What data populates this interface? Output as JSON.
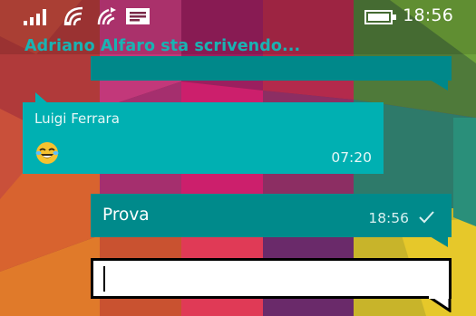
{
  "status_bar": {
    "icons": [
      "signal-bars-icon",
      "wifi-icon",
      "data-transfer-icon",
      "message-notification-icon",
      "battery-icon"
    ],
    "time": "18:56"
  },
  "chat": {
    "typing_indicator": "Adriano Alfaro sta scrivendo...",
    "messages": [
      {
        "direction": "outgoing",
        "text": "",
        "time": "",
        "clipped": true
      },
      {
        "direction": "incoming",
        "sender": "Luigi Ferrara",
        "emoji": "face-with-tears-of-joy",
        "time": "07:20"
      },
      {
        "direction": "outgoing",
        "text": "Prova",
        "time": "18:56",
        "status": "sent-check-icon"
      }
    ],
    "composer": {
      "value": "",
      "placeholder": ""
    }
  },
  "colors": {
    "typing_text": "#19b3b3",
    "incoming_bubble": "#00b0b2",
    "outgoing_bubble": "#008a8b",
    "composer_border": "#000000"
  }
}
